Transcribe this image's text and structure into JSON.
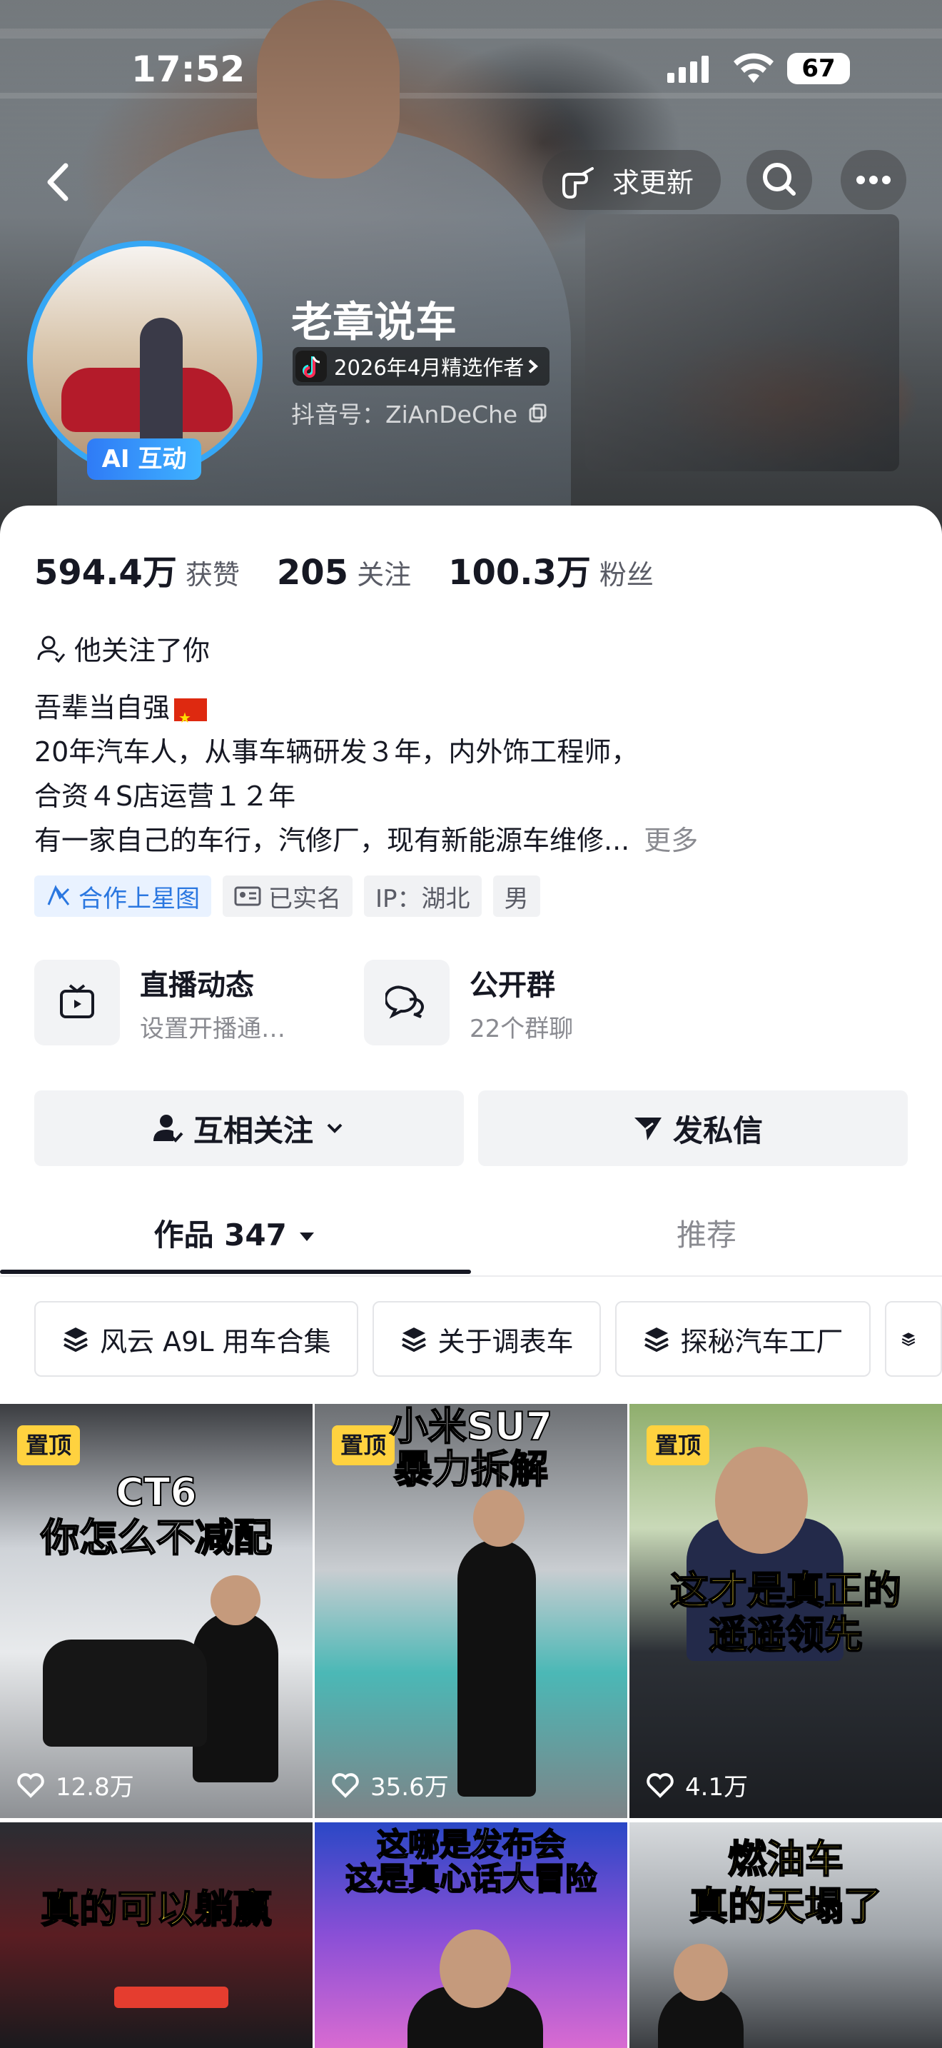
{
  "status_bar": {
    "time": "17:52",
    "battery": "67"
  },
  "header": {
    "update_request": "求更新"
  },
  "profile": {
    "name": "老章说车",
    "ai_badge": "AI 互动",
    "featured_author": "2026年4月精选作者",
    "douyin_id": "抖音号：ZiAnDeChe"
  },
  "stats": [
    {
      "value": "594.4万",
      "label": "获赞"
    },
    {
      "value": "205",
      "label": "关注"
    },
    {
      "value": "100.3万",
      "label": "粉丝"
    }
  ],
  "follows_you": "他关注了你",
  "bio": {
    "lines": [
      "吾辈当自强",
      "20年汽车人，从事车辆研发３年，内外饰工程师，",
      "合资４S店运营１２年",
      "有一家自己的车行，汽修厂，现有新能源车维修..."
    ],
    "more": "更多"
  },
  "tags": [
    "合作上星图",
    "已实名",
    "IP：湖北",
    "男"
  ],
  "entries": [
    {
      "title": "直播动态",
      "subtitle": "设置开播通…"
    },
    {
      "title": "公开群",
      "subtitle": "22个群聊"
    }
  ],
  "actions": {
    "mutual_follow": "互相关注",
    "message": "发私信"
  },
  "tabs": [
    {
      "label": "作品 347",
      "active": true
    },
    {
      "label": "推荐",
      "active": false
    }
  ],
  "collections": [
    "风云 A9L 用车合集",
    "关于调表车",
    "探秘汽车工厂"
  ],
  "videos": [
    {
      "pinned": "置顶",
      "title": [
        "CT6",
        "你怎么不减配"
      ],
      "likes": "12.8万"
    },
    {
      "pinned": "置顶",
      "title": [
        "小米SU7",
        "暴力拆解"
      ],
      "likes": "35.6万"
    },
    {
      "pinned": "置顶",
      "title": [
        "这才是真正的",
        "遥遥领先"
      ],
      "likes": "4.1万"
    },
    {
      "title": [
        "真的可以躺赢"
      ]
    },
    {
      "title": [
        "这哪是发布会",
        "这是真心话大冒险"
      ]
    },
    {
      "title": [
        "燃油车",
        "真的天塌了"
      ]
    }
  ],
  "colors": {
    "accent_blue": "#2a77e0",
    "ring_blue": "#36a7f5",
    "pin_yellow": "#ffd23f"
  }
}
